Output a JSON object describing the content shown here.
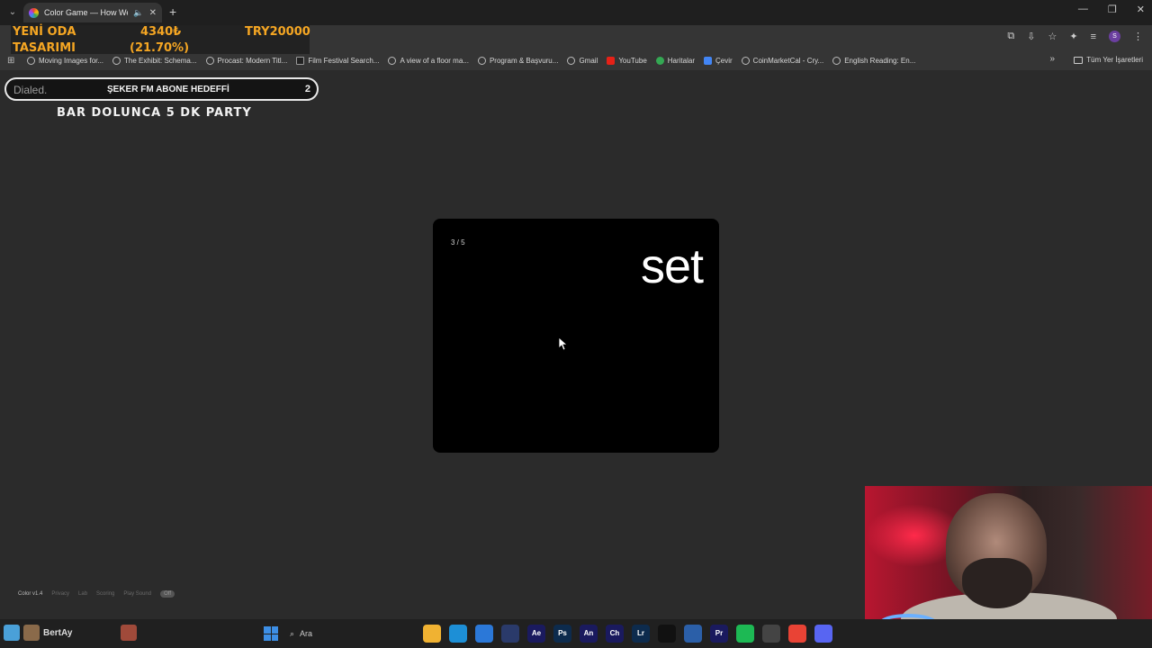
{
  "browser": {
    "tab": {
      "title": "Color Game — How Well C..."
    },
    "window_controls": [
      "—",
      "❐",
      "✕"
    ],
    "bookmarks": [
      {
        "label": "Moving Images for...",
        "icon": "globe-icon"
      },
      {
        "label": "The Exhibit: Schema...",
        "icon": "globe-icon"
      },
      {
        "label": "Procast: Modern Titl...",
        "icon": "globe-icon"
      },
      {
        "label": "Film Festival Search...",
        "icon": "film-icon"
      },
      {
        "label": "A view of a floor ma...",
        "icon": "globe-icon"
      },
      {
        "label": "Program & Başvuru...",
        "icon": "globe-icon"
      },
      {
        "label": "Gmail",
        "icon": "globe-icon"
      },
      {
        "label": "YouTube",
        "icon": "youtube-icon"
      },
      {
        "label": "Haritalar",
        "icon": "maps-icon"
      },
      {
        "label": "Çevir",
        "icon": "translate-icon"
      },
      {
        "label": "CoinMarketCal - Cry...",
        "icon": "globe-icon"
      },
      {
        "label": "English Reading: En...",
        "icon": "globe-icon"
      }
    ],
    "all_bookmarks_label": "Tüm Yer İşaretleri",
    "profile_initial": "S"
  },
  "overlay": {
    "goal_label_line1": "YENİ ODA",
    "goal_label_line2": "TASARIMI",
    "goal_amount": "4340₺",
    "goal_percent": "(21.70%)",
    "goal_target": "TRY20000",
    "sub_goal_logo": "Dialed.",
    "sub_goal_label": "ŞEKER FM ABONE HEDEFFİ",
    "sub_goal_count": "2",
    "party_text": "BAR DOLUNCA 5 DK PARTY"
  },
  "game": {
    "counter": "3 / 5",
    "word": "set",
    "card_color": "#000000"
  },
  "footer": {
    "version": "Color v1.4",
    "links": [
      "Privacy",
      "Lab",
      "Scoring",
      "Play Sound"
    ],
    "sound_state": "Off"
  },
  "taskbar": {
    "user_label": "BertAy",
    "search_placeholder": "Ara",
    "apps": [
      {
        "name": "file-explorer",
        "label": "",
        "color": "#f0b232"
      },
      {
        "name": "edge",
        "label": "",
        "color": "#1d8fd6"
      },
      {
        "name": "store",
        "label": "",
        "color": "#2b78d8"
      },
      {
        "name": "cinema4d",
        "label": "",
        "color": "#2a3a6a"
      },
      {
        "name": "after-effects",
        "label": "Ae",
        "color": "#1a1a5e"
      },
      {
        "name": "photoshop",
        "label": "Ps",
        "color": "#0d2b4d"
      },
      {
        "name": "animate",
        "label": "An",
        "color": "#1a1a5e"
      },
      {
        "name": "character-animator",
        "label": "Ch",
        "color": "#1a1a5e"
      },
      {
        "name": "lightroom",
        "label": "Lr",
        "color": "#0d2b4d"
      },
      {
        "name": "vectorworks",
        "label": "",
        "color": "#111111"
      },
      {
        "name": "blender",
        "label": "",
        "color": "#2b5fa8"
      },
      {
        "name": "premiere",
        "label": "Pr",
        "color": "#1a1a5e"
      },
      {
        "name": "spotify",
        "label": "",
        "color": "#1db954"
      },
      {
        "name": "davinci",
        "label": "",
        "color": "#444444"
      },
      {
        "name": "chrome",
        "label": "",
        "color": "#e94335"
      },
      {
        "name": "discord",
        "label": "",
        "color": "#5865f2"
      }
    ]
  }
}
